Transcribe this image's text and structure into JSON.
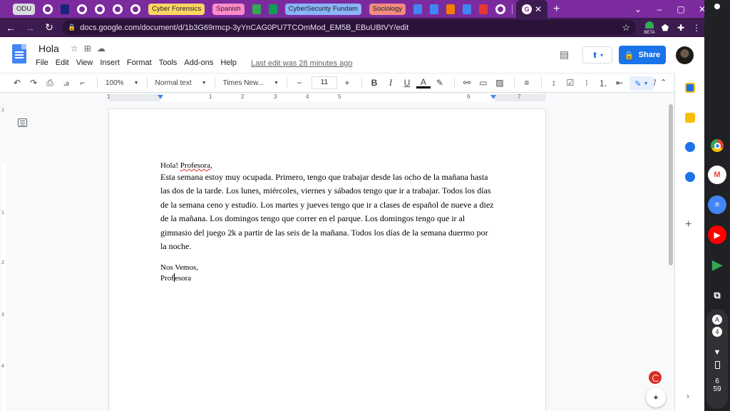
{
  "browser": {
    "tabs": [
      {
        "kind": "group",
        "label": "ODU",
        "color": "#dadce0"
      },
      {
        "kind": "icon",
        "icon": "chrome-icon"
      },
      {
        "kind": "icon",
        "icon": "blue-flag-icon"
      },
      {
        "kind": "icon",
        "icon": "chrome-icon"
      },
      {
        "kind": "icon",
        "icon": "chrome-icon"
      },
      {
        "kind": "icon",
        "icon": "chrome-icon"
      },
      {
        "kind": "icon",
        "icon": "chrome-icon"
      },
      {
        "kind": "group",
        "label": "Cyber Forensics",
        "color": "#fdd663"
      },
      {
        "kind": "group",
        "label": "Spanish",
        "color": "#ff8bcb"
      },
      {
        "kind": "icon",
        "icon": "green-chat-icon"
      },
      {
        "kind": "icon",
        "icon": "classroom-icon"
      },
      {
        "kind": "group",
        "label": "CyberSecurity Fundam",
        "color": "#8ab4f8"
      },
      {
        "kind": "group",
        "label": "Sociology",
        "color": "#f28b82"
      },
      {
        "kind": "icon",
        "icon": "docs-icon"
      },
      {
        "kind": "icon",
        "icon": "docs-icon"
      },
      {
        "kind": "icon",
        "icon": "orange-c-icon"
      },
      {
        "kind": "icon",
        "icon": "docs-icon"
      },
      {
        "kind": "icon",
        "icon": "red-app-icon"
      },
      {
        "kind": "icon",
        "icon": "chrome-icon"
      }
    ],
    "url": "docs.google.com/document/d/1b3G69rmcp-3yYnCAG0PU7TCOmMod_EM5B_EBuUBtVY/edit",
    "beta_label": "BETA"
  },
  "docs": {
    "title": "Hola",
    "menu": [
      "File",
      "Edit",
      "View",
      "Insert",
      "Format",
      "Tools",
      "Add-ons",
      "Help"
    ],
    "last_edit": "Last edit was 28 minutes ago",
    "share_label": "Share"
  },
  "toolbar": {
    "zoom": "100%",
    "style": "Normal text",
    "font": "Times New...",
    "font_size": "11",
    "bold": "B",
    "italic": "I",
    "underline": "U",
    "text_color": "A"
  },
  "ruler": {
    "numbers": [
      "1",
      "1",
      "2",
      "3",
      "4",
      "5",
      "6",
      "7"
    ],
    "vertical_numbers": [
      "1",
      "1",
      "2",
      "3",
      "4"
    ]
  },
  "document": {
    "greeting_prefix": "Hola! ",
    "greeting_name": "Profesora",
    "greeting_suffix": ",",
    "paragraph": "Esta semana estoy muy ocupada. Primero, tengo que trabajar desde las ocho de la mañana hasta las dos de la tarde. Los lunes, miércoles, viernes y sábados tengo que ir a trabajar. Todos los días de la semana ceno y estudio. Los martes y jueves tengo que ir a clases de español de nueve a diez de la mañana. Los domingos tengo que correr en el parque. Los domingos tengo que ir al gimnasio del juego 2k a partir de las seis de la mañana. Todos los días de la semana duermo por la noche.",
    "closing": "Nos Vemos,",
    "signature_before_cursor": "Prof",
    "signature_after_cursor": "esora"
  },
  "shelf": {
    "notification_count": "4",
    "clock_hour": "6",
    "clock_minute": "59"
  }
}
